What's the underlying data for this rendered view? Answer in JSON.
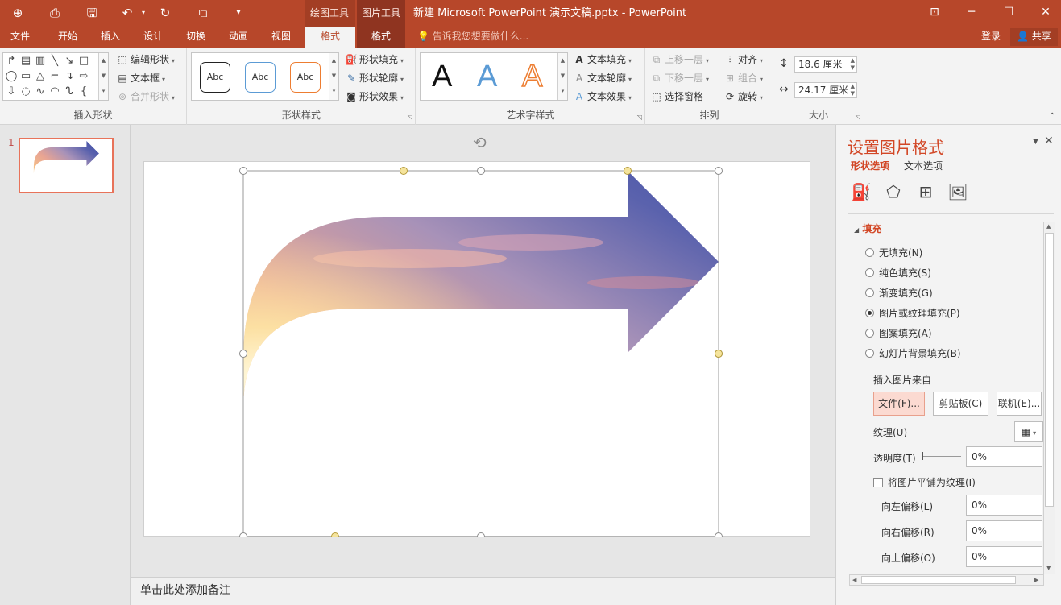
{
  "titlebar": {
    "title": "新建 Microsoft PowerPoint 演示文稿.pptx - PowerPoint",
    "context_drawing": "绘图工具",
    "context_picture": "图片工具",
    "icons": [
      "touch-mode-icon",
      "presenter-icon",
      "save-icon",
      "undo-icon",
      "redo-icon",
      "slideshow-icon",
      "customize-icon"
    ]
  },
  "tabs": {
    "file": "文件",
    "home": "开始",
    "insert": "插入",
    "design": "设计",
    "transitions": "切换",
    "animations": "动画",
    "slideshow": "视图",
    "format_drawing": "格式",
    "format_picture": "格式",
    "tell_me": "告诉我您想要做什么...",
    "login": "登录",
    "share": "共享"
  },
  "ribbon": {
    "insert_shapes": {
      "label": "插入形状",
      "edit_shape": "编辑形状",
      "text_box": "文本框",
      "merge_shapes": "合并形状"
    },
    "shape_styles": {
      "label": "形状样式",
      "swatch": "Abc",
      "fill": "形状填充",
      "outline": "形状轮廓",
      "effects": "形状效果"
    },
    "wordart": {
      "label": "艺术字样式",
      "letter": "A",
      "text_fill": "文本填充",
      "text_outline": "文本轮廓",
      "text_effects": "文本效果"
    },
    "arrange": {
      "label": "排列",
      "bring_forward": "上移一层",
      "send_backward": "下移一层",
      "selection_pane": "选择窗格",
      "align": "对齐",
      "group": "组合",
      "rotate": "旋转"
    },
    "size": {
      "label": "大小",
      "height": "18.6 厘米",
      "width": "24.17 厘米"
    }
  },
  "thumbs": {
    "slide_number": "1"
  },
  "notes": {
    "placeholder": "单击此处添加备注"
  },
  "pane": {
    "title": "设置图片格式",
    "tab_shape": "形状选项",
    "tab_text": "文本选项",
    "section": "填充",
    "fill_options": [
      {
        "label": "无填充(N)",
        "selected": false
      },
      {
        "label": "纯色填充(S)",
        "selected": false
      },
      {
        "label": "渐变填充(G)",
        "selected": false
      },
      {
        "label": "图片或纹理填充(P)",
        "selected": true
      },
      {
        "label": "图案填充(A)",
        "selected": false
      },
      {
        "label": "幻灯片背景填充(B)",
        "selected": false
      }
    ],
    "insert_from": "插入图片来自",
    "btn_file": "文件(F)...",
    "btn_clipboard": "剪贴板(C)",
    "btn_online": "联机(E)...",
    "texture": "纹理(U)",
    "transparency": "透明度(T)",
    "transparency_value": "0%",
    "tile": "将图片平铺为纹理(I)",
    "offset_left": "向左偏移(L)",
    "offset_left_value": "0%",
    "offset_right": "向右偏移(R)",
    "offset_right_value": "0%",
    "offset_up": "向上偏移(O)",
    "offset_up_value": "0%"
  },
  "colors": {
    "accent": "#b7472a",
    "pane_accent": "#d24726",
    "handle": "#f5e49c"
  }
}
